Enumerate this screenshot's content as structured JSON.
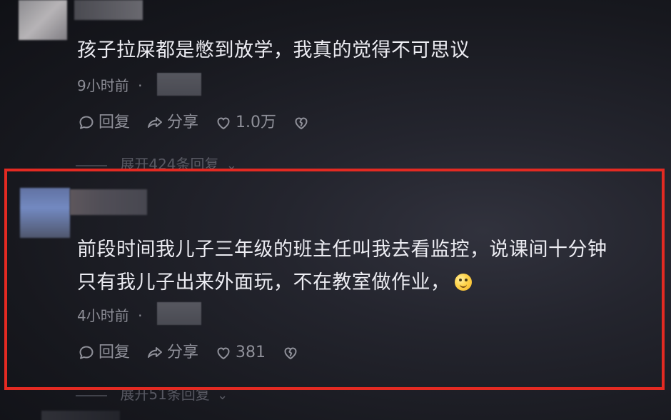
{
  "comments": [
    {
      "text_lines": [
        "孩子拉屎都是憋到放学，我真的觉得不可思议"
      ],
      "time": "9小时前",
      "separator": "·",
      "reply_label": "回复",
      "share_label": "分享",
      "like_count": "1.0万",
      "expand_label": "展开424条回复",
      "expand_chevron": "⌄"
    },
    {
      "text_lines": [
        "前段时间我儿子三年级的班主任叫我去看监控，说课间十分钟",
        "只有我儿子出来外面玩，不在教室做作业，"
      ],
      "time": "4小时前",
      "separator": "·",
      "reply_label": "回复",
      "share_label": "分享",
      "like_count": "381",
      "expand_label": "展开51条回复",
      "expand_chevron": "⌄",
      "emoji_icon": "grinning-face-icon"
    }
  ],
  "icons": {
    "reply": "comment-bubble-icon",
    "share": "share-arrow-icon",
    "like": "heart-icon",
    "dislike": "broken-heart-icon"
  },
  "colors": {
    "background": "#17181e",
    "text": "#ececf2",
    "meta": "#8c8d96",
    "highlight_border": "#e32a22"
  }
}
